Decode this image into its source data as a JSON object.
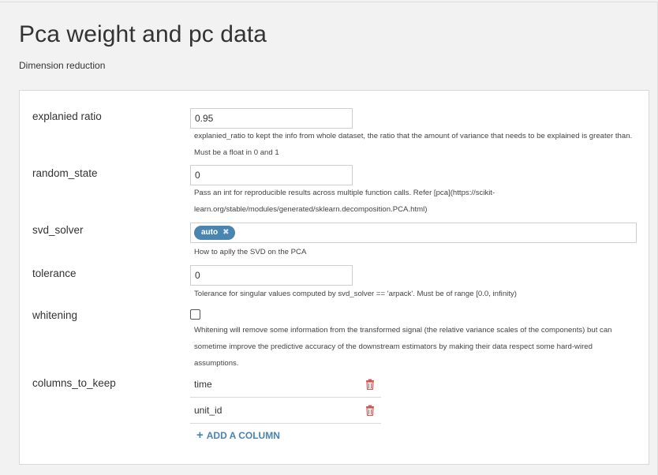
{
  "page": {
    "title": "Pca weight and pc data",
    "subtitle": "Dimension reduction"
  },
  "fields": {
    "explained_ratio": {
      "label": "explanied ratio",
      "value": "0.95",
      "help": "explanied_ratio to kept the info from whole dataset, the ratio that the amount of variance that needs to be explained is greater than. Must be a float in 0 and 1"
    },
    "random_state": {
      "label": "random_state",
      "value": "0",
      "help": "Pass an int for reproducible results across multiple function calls. Refer [pca](https://scikit-learn.org/stable/modules/generated/sklearn.decomposition.PCA.html)"
    },
    "svd_solver": {
      "label": "svd_solver",
      "tag": "auto",
      "tag_remove_icon": "close-x-icon",
      "help": "How to aplly the SVD on the PCA"
    },
    "tolerance": {
      "label": "tolerance",
      "value": "0",
      "help": "Tolerance for singular values computed by svd_solver == 'arpack'. Must be of range [0.0, infinity)"
    },
    "whitening": {
      "label": "whitening",
      "checked": false,
      "help": "Whitening will remove some information from the transformed signal (the relative variance scales of the components) but can sometime improve the predictive accuracy of the downstream estimators by making their data respect some hard-wired assumptions."
    },
    "columns_to_keep": {
      "label": "columns_to_keep",
      "columns": [
        "time",
        "unit_id"
      ],
      "delete_icon": "trash-icon",
      "add_label": "ADD A COLUMN",
      "add_icon": "plus-icon"
    }
  },
  "colors": {
    "accent": "#4a84b0",
    "delete": "#d9534f",
    "background": "#f2f2f2"
  }
}
